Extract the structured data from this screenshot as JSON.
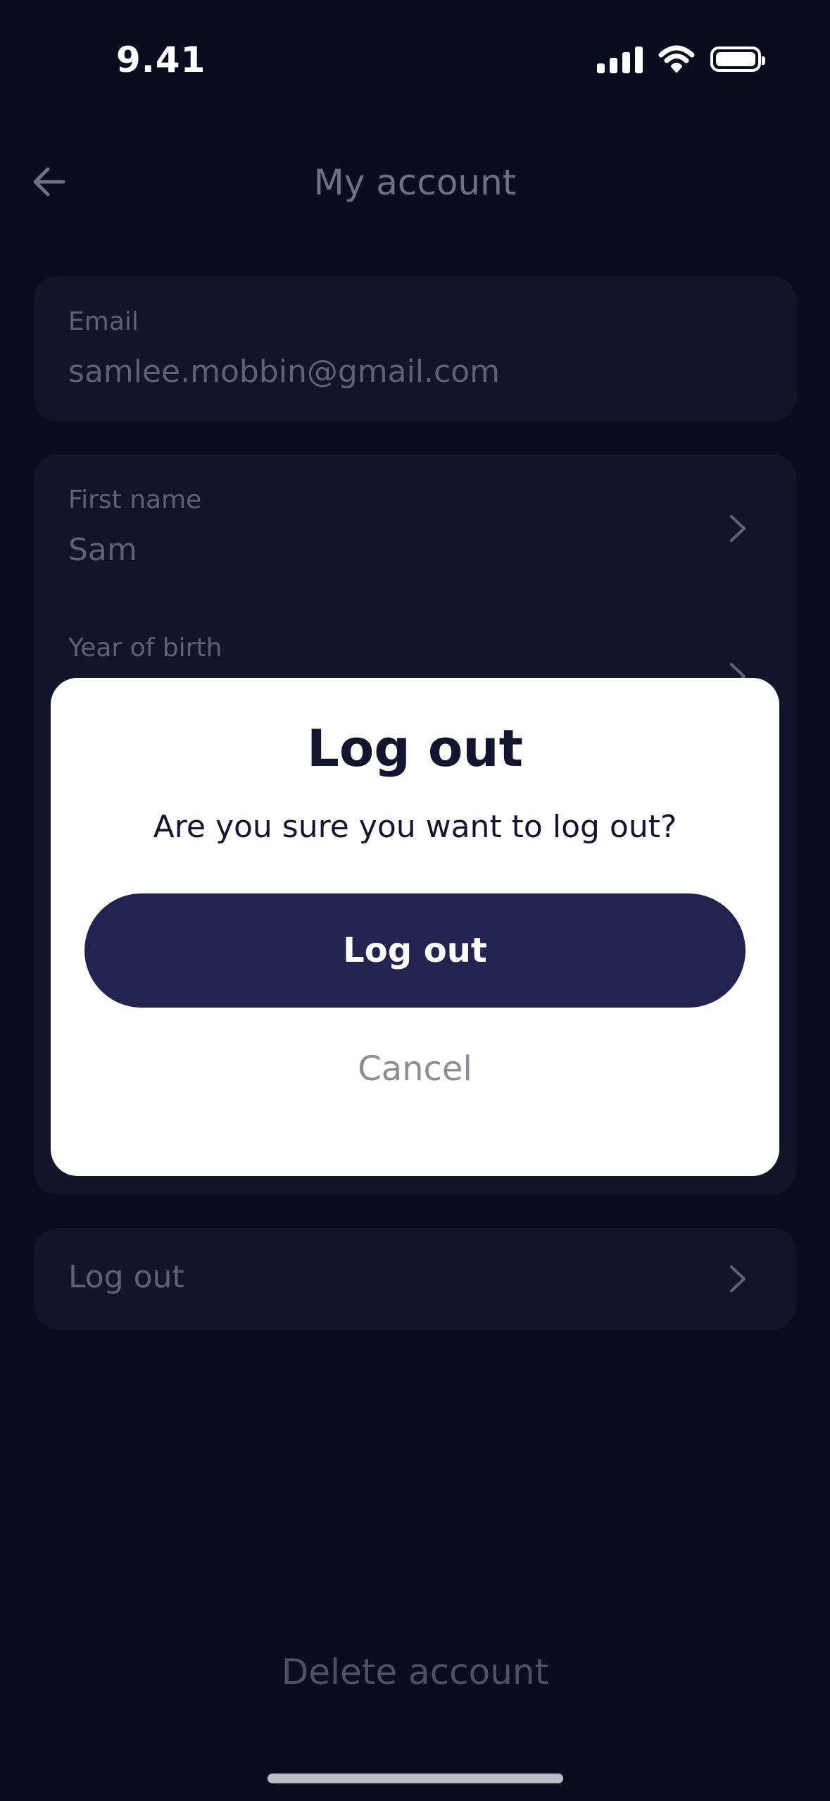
{
  "status_bar": {
    "time": "9.41",
    "icons": [
      "cellular-signal-icon",
      "wifi-icon",
      "battery-icon"
    ]
  },
  "header": {
    "back_icon": "arrow-left-icon",
    "title": "My account"
  },
  "email_card": {
    "label": "Email",
    "value": "samlee.mobbin@gmail.com"
  },
  "profile_card": {
    "first_name_label": "First name",
    "first_name_value": "Sam",
    "year_label": "Year of birth"
  },
  "logout_row": {
    "label": "Log out"
  },
  "footer": {
    "delete_label": "Delete account"
  },
  "modal": {
    "title": "Log out",
    "message": "Are you sure you want to log out?",
    "confirm_label": "Log out",
    "cancel_label": "Cancel"
  },
  "colors": {
    "background": "#0a0c20",
    "card": "#12142b",
    "primary_button": "#22244f",
    "muted_text": "#5f6276"
  }
}
